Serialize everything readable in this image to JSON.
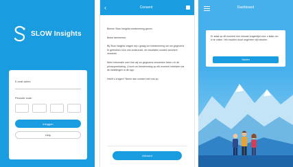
{
  "login": {
    "app_name": "SLOW Insights",
    "email_label": "E-mail adres",
    "pin_label": "Pincode code",
    "primary_button": "Inloggen",
    "secondary_button": "Help"
  },
  "consent": {
    "title": "Consent",
    "paragraphs": [
      "Binnen Slow Insights toestemming geven",
      "Beste deelnemer,",
      "Bij Slow Insights vragen wij u graag om toestemming om uw gegevens te gebruiken voor ons onderzoek, de resultaten worden anoniem verwerkt.",
      "Meer informatie over hoe wij uw gegevens verwerken leest u in de privacyverklaring. U kunt uw toestemming op elk moment intrekken via de instellingen in de app.",
      "Heeft u vragen? Neem dan contact met ons op."
    ],
    "button": "Akkoord"
  },
  "welcome": {
    "title": "Dashboard",
    "dialog_text": "Er staat op dit moment een nieuwe vragenlijst voor u klaar om in te vullen. Het invullen duurt ongeveer vijf minuten.",
    "dialog_button": "Starten"
  },
  "colors": {
    "brand": "#1a9de0",
    "sky": "#46b0ec",
    "white": "#ffffff"
  }
}
